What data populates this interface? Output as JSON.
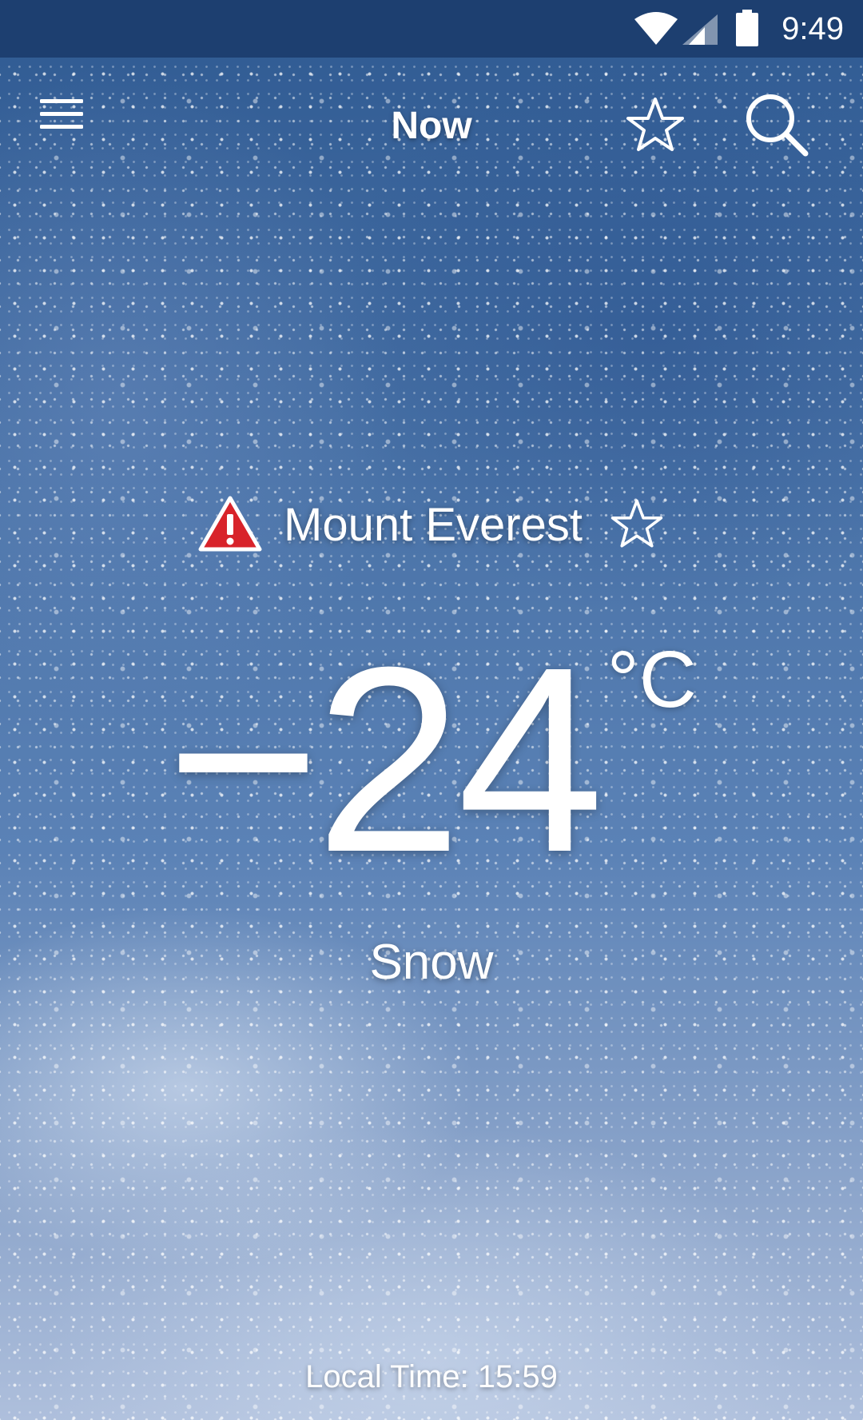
{
  "status_bar": {
    "time": "9:49",
    "icons": [
      "wifi-icon",
      "cellular-signal-icon",
      "battery-icon"
    ]
  },
  "app_bar": {
    "title": "Now",
    "icons": [
      "menu-icon",
      "star-outline-icon",
      "search-icon"
    ]
  },
  "location": {
    "name": "Mount Everest",
    "alert_icon": "warning-triangle-icon",
    "alert_color": "#d8232a",
    "favorite_icon": "star-outline-icon"
  },
  "current": {
    "temperature": "−24",
    "unit": "°C",
    "condition": "Snow"
  },
  "footer": {
    "label": "Local Time:",
    "time": "15:59"
  },
  "colors": {
    "status_bar_bg": "#1d3f70",
    "text": "#ffffff"
  }
}
